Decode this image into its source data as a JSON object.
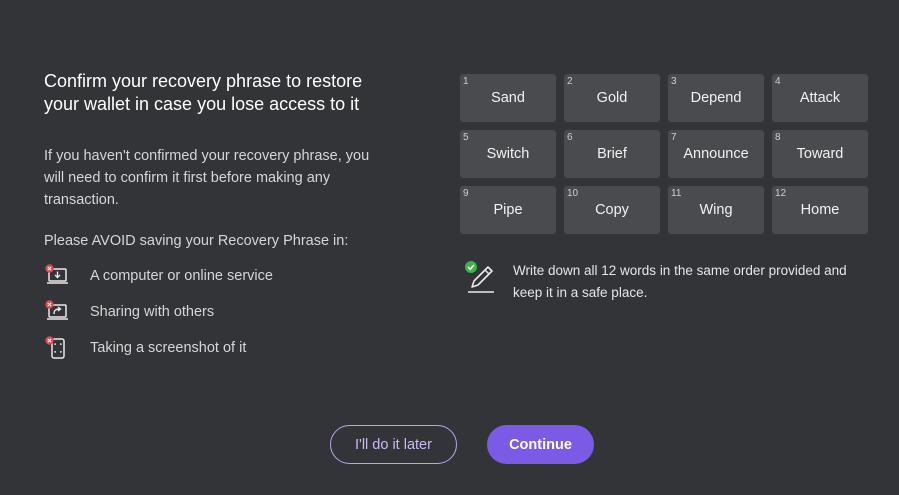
{
  "header": {
    "title_line1": "Confirm your recovery phrase to restore",
    "title_line2": "your wallet in case you lose access to it"
  },
  "description": {
    "line1": "If you haven't confirmed your recovery phrase, you",
    "line2": "will need to confirm it first before making any",
    "line3": "transaction."
  },
  "avoid": {
    "title": "Please AVOID saving your Recovery Phrase in:",
    "items": [
      {
        "label": "A computer or online service",
        "icon": "computer-download-icon"
      },
      {
        "label": "Sharing with others",
        "icon": "share-icon"
      },
      {
        "label": "Taking a screenshot of it",
        "icon": "phone-screenshot-icon"
      }
    ]
  },
  "words": [
    {
      "num": "1",
      "word": "Sand"
    },
    {
      "num": "2",
      "word": "Gold"
    },
    {
      "num": "3",
      "word": "Depend"
    },
    {
      "num": "4",
      "word": "Attack"
    },
    {
      "num": "5",
      "word": "Switch"
    },
    {
      "num": "6",
      "word": "Brief"
    },
    {
      "num": "7",
      "word": "Announce"
    },
    {
      "num": "8",
      "word": "Toward"
    },
    {
      "num": "9",
      "word": "Pipe"
    },
    {
      "num": "10",
      "word": "Copy"
    },
    {
      "num": "11",
      "word": "Wing"
    },
    {
      "num": "12",
      "word": "Home"
    }
  ],
  "note": {
    "line1": "Write down all 12 words in the same order provided and",
    "line2": "keep it in a safe place.",
    "icon": "pen-check-icon"
  },
  "buttons": {
    "later": "I'll do it later",
    "continue": "Continue"
  },
  "colors": {
    "background": "#333437",
    "tile": "#4a4b4f",
    "accent": "#7b5be6",
    "warning": "#e0434d",
    "success": "#3bb54a"
  }
}
